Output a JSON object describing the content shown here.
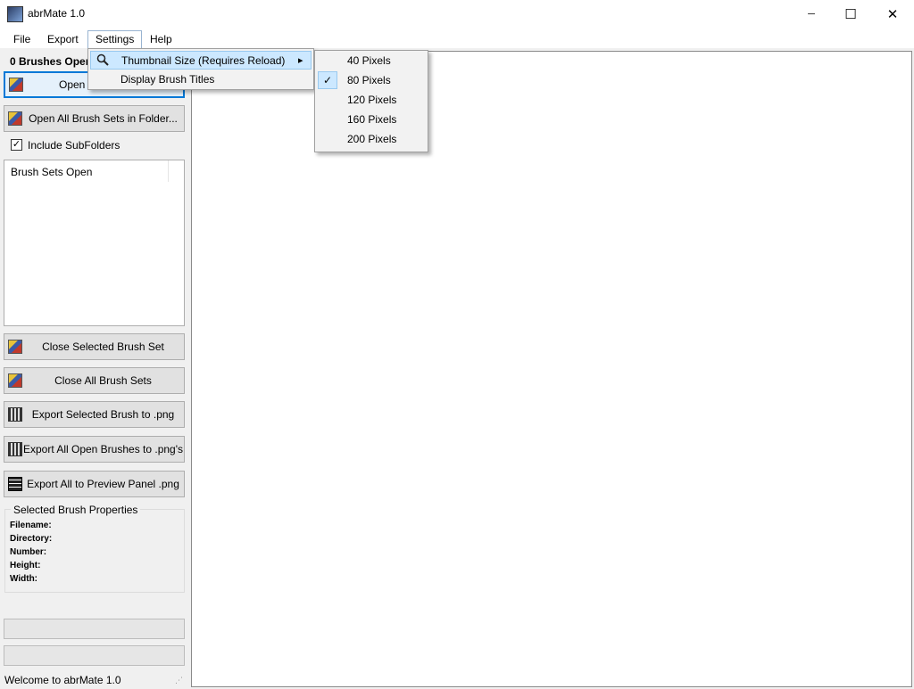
{
  "window": {
    "title": "abrMate 1.0",
    "minimize_glyph": "─",
    "maximize_glyph": "☐",
    "close_glyph": "✕"
  },
  "menubar": {
    "file": "File",
    "export": "Export",
    "settings": "Settings",
    "help": "Help"
  },
  "left": {
    "brushes_open_label": "0 Brushes Open",
    "open_button": "Open Brush Set...",
    "open_all_button": "Open All Brush Sets in Folder...",
    "include_subfolders": "Include SubFolders",
    "list_header": "Brush Sets Open",
    "close_selected": "Close Selected Brush Set",
    "close_all": "Close All Brush Sets",
    "export_selected": "Export Selected Brush to .png",
    "export_all": "Export All Open Brushes to .png's",
    "export_preview": "Export All to Preview Panel .png",
    "props_title": "Selected Brush Properties",
    "props": {
      "filename": "Filename:",
      "directory": "Directory:",
      "number": "Number:",
      "height": "Height:",
      "width": "Width:"
    }
  },
  "status": {
    "text": "Welcome to abrMate 1.0"
  },
  "settings_menu": {
    "thumbnail_size": "Thumbnail Size (Requires Reload)",
    "display_titles": "Display Brush Titles",
    "arrow": "▸"
  },
  "thumbnail_menu": {
    "checkmark": "✓",
    "options": [
      "40 Pixels",
      "80 Pixels",
      "120 Pixels",
      "160 Pixels",
      "200 Pixels"
    ],
    "selected": "80 Pixels"
  },
  "colors": {
    "highlight": "#cce8ff",
    "highlight_border": "#99c9ef",
    "focus": "#0078d7"
  }
}
